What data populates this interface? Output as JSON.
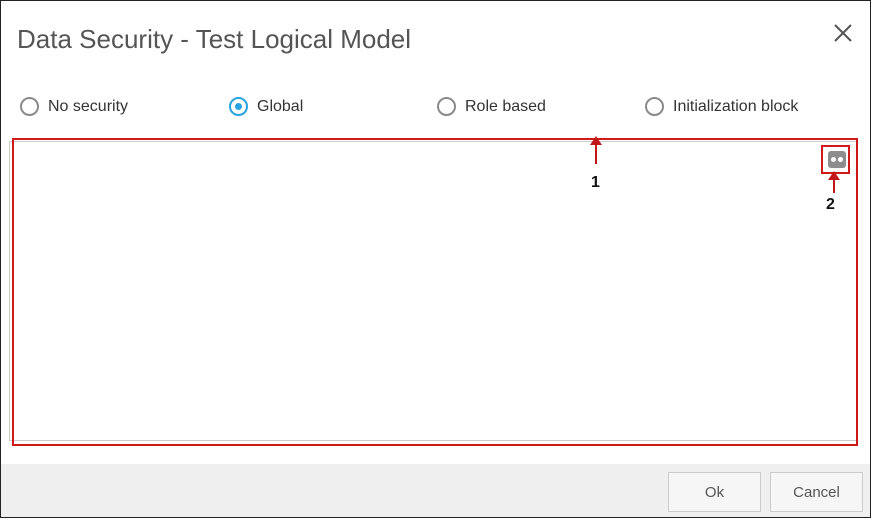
{
  "dialog": {
    "title": "Data Security - Test Logical Model"
  },
  "radios": [
    {
      "label": "No security",
      "selected": false
    },
    {
      "label": "Global",
      "selected": true
    },
    {
      "label": "Role based",
      "selected": false
    },
    {
      "label": "Initialization block",
      "selected": false
    }
  ],
  "annotations": {
    "one": "1",
    "two": "2"
  },
  "footer": {
    "ok": "Ok",
    "cancel": "Cancel"
  },
  "colors": {
    "accent": "#29a3e0",
    "annotation": "#d01a1a"
  }
}
